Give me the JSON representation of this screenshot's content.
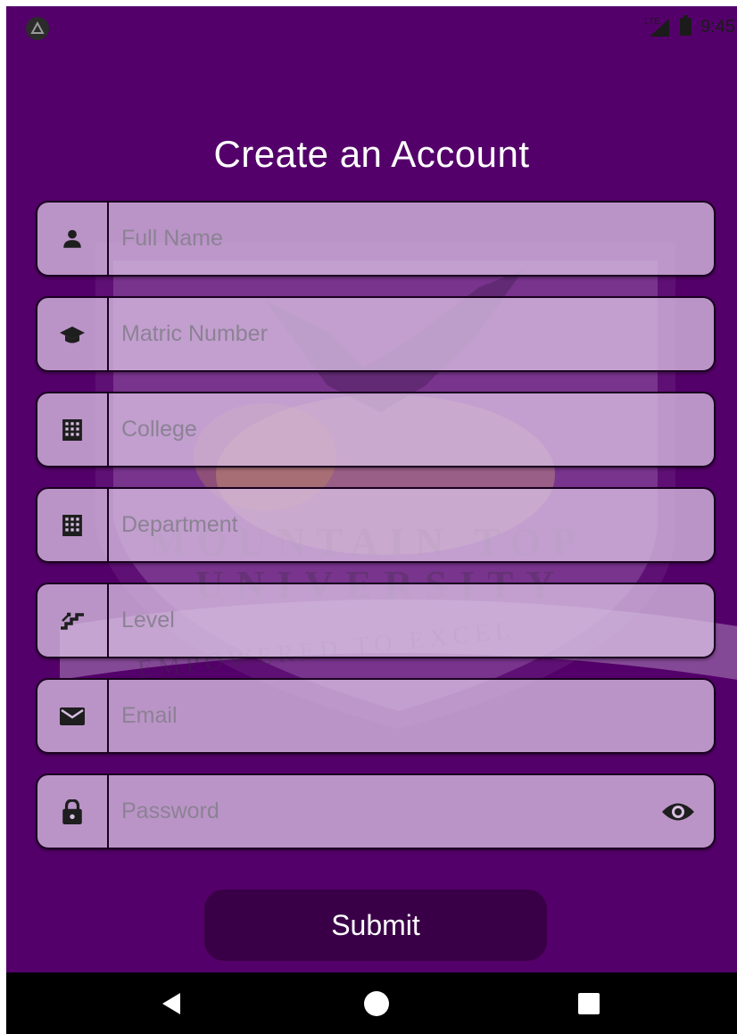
{
  "status_bar": {
    "time": "9:45",
    "network": "LTE",
    "icons": [
      "app-notification-icon",
      "lte-signal-icon",
      "battery-icon"
    ]
  },
  "watermark": {
    "line1": "MOUNTAIN TOP",
    "line2": "UNIVERSITY",
    "motto": "EMPOWERED TO EXCEL"
  },
  "title": "Create an Account",
  "fields": [
    {
      "icon": "person-icon",
      "placeholder": "Full Name"
    },
    {
      "icon": "graduation-cap-icon",
      "placeholder": "Matric Number"
    },
    {
      "icon": "building-icon",
      "placeholder": "College"
    },
    {
      "icon": "building-icon",
      "placeholder": "Department"
    },
    {
      "icon": "stairs-icon",
      "placeholder": "Level"
    },
    {
      "icon": "email-icon",
      "placeholder": "Email"
    },
    {
      "icon": "lock-icon",
      "placeholder": "Password",
      "trailing_icon": "eye-icon"
    }
  ],
  "submit_label": "Submit",
  "nav": [
    "back-icon",
    "home-icon",
    "recents-icon"
  ],
  "colors": {
    "background": "#54006a",
    "field_fill": "#d7bee2",
    "button": "#3a0047",
    "navbar": "#000000"
  }
}
